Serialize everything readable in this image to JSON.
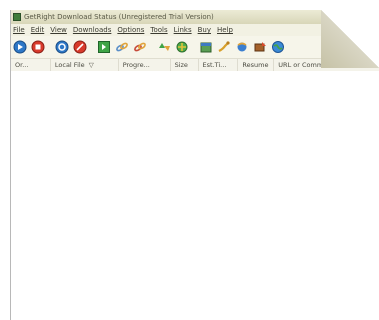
{
  "window": {
    "title": "GetRight Download Status (Unregistered Trial Version)"
  },
  "menubar": {
    "items": [
      {
        "label": "File"
      },
      {
        "label": "Edit"
      },
      {
        "label": "View"
      },
      {
        "label": "Downloads"
      },
      {
        "label": "Options"
      },
      {
        "label": "Tools"
      },
      {
        "label": "Links"
      },
      {
        "label": "Buy"
      },
      {
        "label": "Help"
      }
    ]
  },
  "toolbar": {
    "icons": [
      "start-download-icon",
      "stop-download-icon",
      "resume-icon",
      "cancel-icon",
      "add-download-icon",
      "link-icon",
      "edit-link-icon",
      "move-up-icon",
      "move-down-icon",
      "schedule-icon",
      "connect-icon",
      "settings-icon",
      "unzip-icon",
      "globe-icon"
    ]
  },
  "grid": {
    "columns": [
      {
        "label": "Or..."
      },
      {
        "label": "Local File"
      },
      {
        "label": "Progre..."
      },
      {
        "label": "Size"
      },
      {
        "label": "Est.Ti..."
      },
      {
        "label": "Resume"
      },
      {
        "label": "URL or Comment"
      }
    ],
    "sort_indicator": "▽"
  }
}
